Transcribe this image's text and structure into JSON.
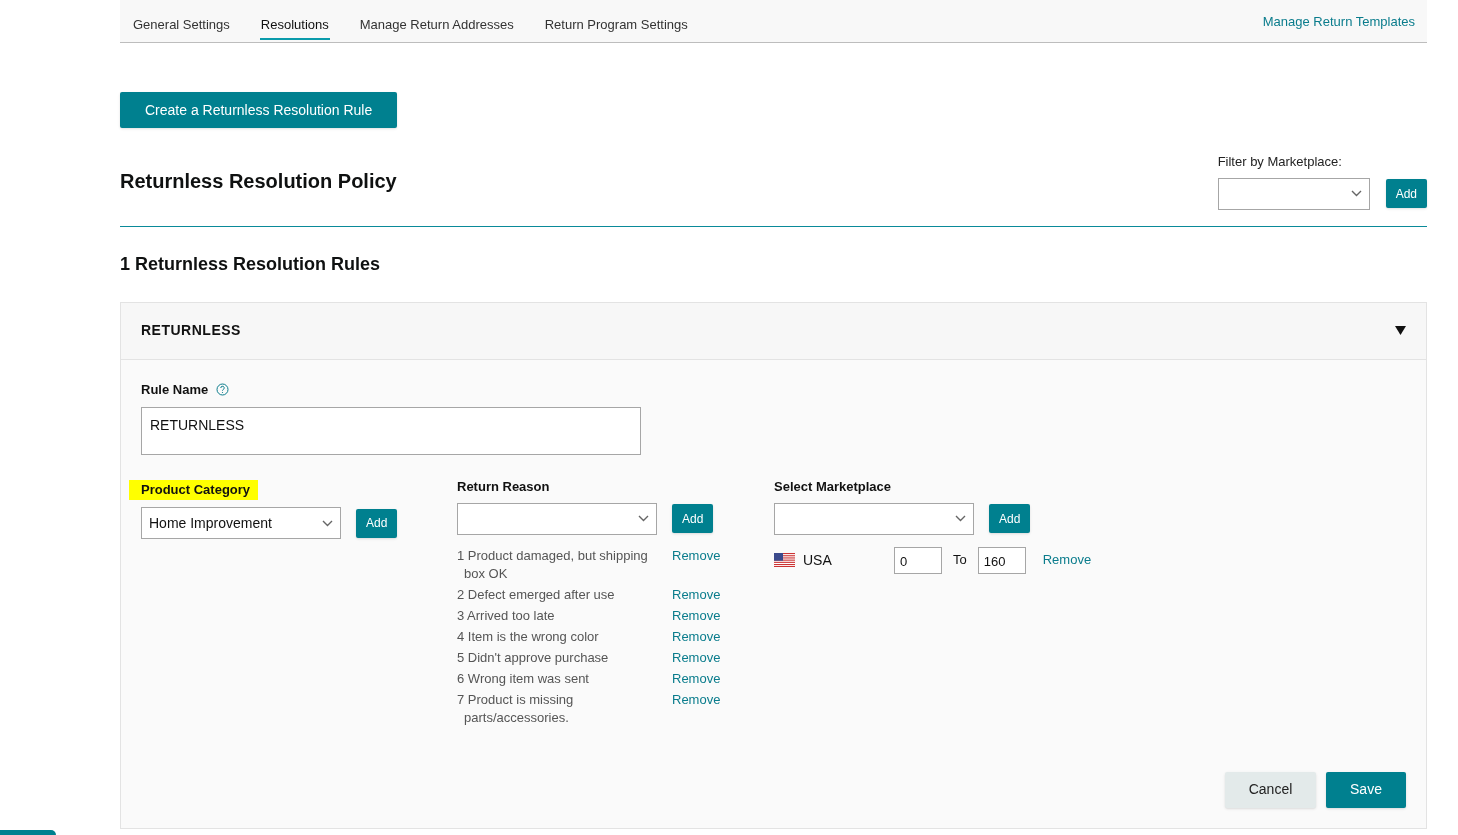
{
  "tabs": [
    {
      "label": "General Settings",
      "selected": false
    },
    {
      "label": "Resolutions",
      "selected": true
    },
    {
      "label": "Manage Return Addresses",
      "selected": false
    },
    {
      "label": "Return Program Settings",
      "selected": false
    }
  ],
  "tabs_link": "Manage Return Templates",
  "create_button": "Create a Returnless Resolution Rule",
  "policy_title": "Returnless Resolution Policy",
  "filter": {
    "label": "Filter by Marketplace:",
    "button": "Add"
  },
  "rules_count_title": "1 Returnless Resolution Rules",
  "rule_card": {
    "header": "RETURNLESS",
    "expanded": true,
    "rule_name": {
      "label": "Rule Name",
      "value": "RETURNLESS"
    },
    "product_category": {
      "label": "Product Category",
      "highlighted": true,
      "value": "Home Improvement",
      "button": "Add"
    },
    "return_reason": {
      "label": "Return Reason",
      "button": "Add",
      "items": [
        {
          "text": "1 Product damaged, but shipping box OK",
          "action": "Remove"
        },
        {
          "text": "2 Defect emerged after use",
          "action": "Remove"
        },
        {
          "text": "3 Arrived too late",
          "action": "Remove"
        },
        {
          "text": "4 Item is the wrong color",
          "action": "Remove"
        },
        {
          "text": "5 Didn't approve purchase",
          "action": "Remove"
        },
        {
          "text": "6 Wrong item was sent",
          "action": "Remove"
        },
        {
          "text": "7 Product is missing parts/accessories.",
          "action": "Remove"
        }
      ]
    },
    "marketplace": {
      "label": "Select Marketplace",
      "button": "Add",
      "items": [
        {
          "name": "USA",
          "from": "0",
          "to_label": "To",
          "to": "160",
          "action": "Remove"
        }
      ]
    },
    "buttons": {
      "cancel": "Cancel",
      "save": "Save"
    }
  }
}
